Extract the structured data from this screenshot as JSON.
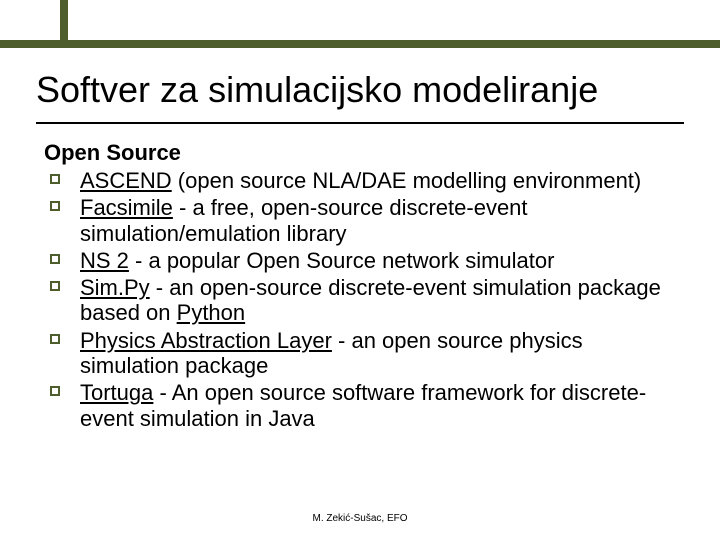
{
  "title": "Softver za simulacijsko modeliranje",
  "subheading": "Open Source",
  "bullets": [
    {
      "link": "ASCEND",
      "rest": " (open source NLA/DAE modelling environment)"
    },
    {
      "link": "Facsimile",
      "rest": " - a free, open-source discrete-event simulation/emulation library"
    },
    {
      "link": "NS 2",
      "rest": " - a popular Open Source network simulator"
    },
    {
      "link": "Sim.Py",
      "rest_pre": " - an open-source discrete-event simulation package based on ",
      "link2": "Python",
      "rest": ""
    },
    {
      "link": "Physics Abstraction Layer",
      "rest": " - an open source physics simulation package"
    },
    {
      "link": "Tortuga",
      "rest": " - An open source software framework for discrete-event simulation in Java"
    }
  ],
  "footer": "M. Zekić-Sušac, EFO"
}
